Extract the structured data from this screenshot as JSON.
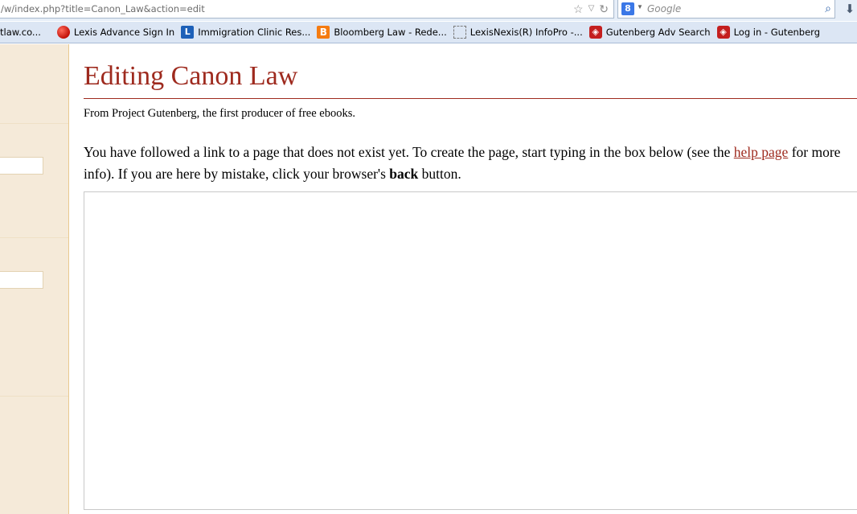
{
  "browser": {
    "url": "/w/index.php?title=Canon_Law&action=edit",
    "search_placeholder": "Google",
    "search_engine_letter": "8"
  },
  "bookmarks": [
    {
      "label": "tlaw.co...",
      "icon": "none"
    },
    {
      "label": "Lexis Advance Sign In",
      "icon": "lexis-red-icon"
    },
    {
      "label": "Immigration Clinic Res...",
      "icon": "l-blue-icon",
      "glyph": "L"
    },
    {
      "label": "Bloomberg Law - Rede...",
      "icon": "b-orange-icon",
      "glyph": "B"
    },
    {
      "label": "LexisNexis(R) InfoPro -...",
      "icon": "blank-page-icon"
    },
    {
      "label": "Gutenberg Adv Search",
      "icon": "gutenberg-icon"
    },
    {
      "label": "Log in - Gutenberg",
      "icon": "gutenberg-icon"
    }
  ],
  "page": {
    "title": "Editing Canon Law",
    "tagline": "From Project Gutenberg, the first producer of free ebooks.",
    "intro_part1": "You have followed a link to a page that does not exist yet. To create the page, start typing in the box below (see the ",
    "help_link": "help page",
    "intro_part2": " for more info). If you are here by mistake, click your browser's ",
    "back_word": "back",
    "intro_part3": " button.",
    "editor_value": ""
  },
  "colors": {
    "title": "#9e2a1e",
    "sidebar_bg": "#f5ead9",
    "link": "#9e2a1e"
  }
}
